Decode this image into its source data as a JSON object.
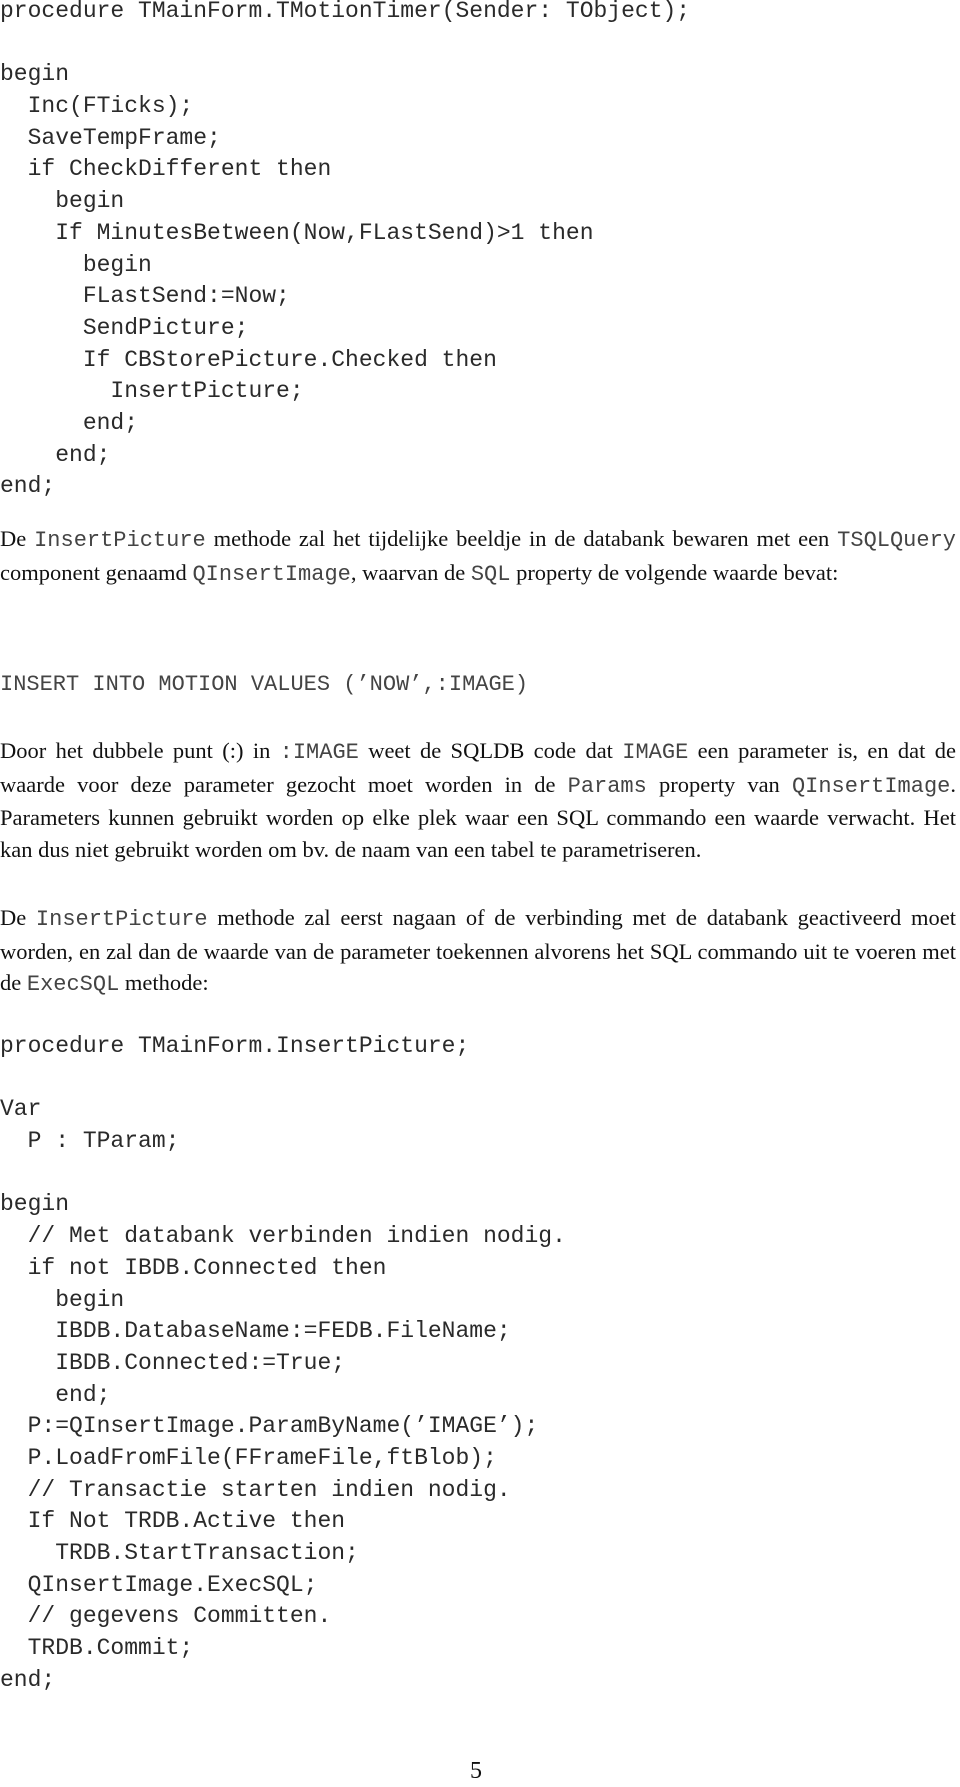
{
  "code_block_1": [
    "procedure TMainForm.TMotionTimer(Sender: TObject);",
    "",
    "begin",
    "  Inc(FTicks);",
    "  SaveTempFrame;",
    "  if CheckDifferent then",
    "    begin",
    "    If MinutesBetween(Now,FLastSend)>1 then",
    "      begin",
    "      FLastSend:=Now;",
    "      SendPicture;",
    "      If CBStorePicture.Checked then",
    "        InsertPicture;",
    "      end;",
    "    end;",
    "end;"
  ],
  "para1": {
    "t1": "De ",
    "c1": "InsertPicture",
    "t2": " methode zal het tijdelijke beeldje in de databank bewaren met een ",
    "c2": "TSQLQuery",
    "t3": " component genaamd ",
    "c3": "QInsertImage",
    "t4": ", waarvan de ",
    "c4": "SQL",
    "t5": " property de volgende waarde bevat:"
  },
  "sql_statement": "INSERT INTO MOTION VALUES (’NOW’,:IMAGE)",
  "para2": {
    "t1": "Door het dubbele punt (:) in ",
    "c1": ":IMAGE",
    "t2": " weet de SQLDB code dat ",
    "c2": "IMAGE",
    "t3": " een parameter is, en dat de waarde voor deze parameter gezocht moet worden in de ",
    "c3": "Params",
    "t4": " property van ",
    "c4": "QInsertImage",
    "t5": ". Parameters kunnen gebruikt worden op elke plek waar een SQL commando een waarde verwacht. Het kan dus niet gebruikt worden om bv. de naam van een tabel te parametriseren."
  },
  "para3": {
    "t1": "De ",
    "c1": "InsertPicture",
    "t2": " methode zal eerst nagaan of de verbinding met de databank geactiveerd moet worden, en zal dan de waarde van de parameter toekennen alvorens het SQL commando uit te voeren met de ",
    "c2": "ExecSQL",
    "t3": " methode:"
  },
  "code_block_2": [
    "procedure TMainForm.InsertPicture;",
    "",
    "Var",
    "  P : TParam;",
    "",
    "begin",
    "  // Met databank verbinden indien nodig.",
    "  if not IBDB.Connected then",
    "    begin",
    "    IBDB.DatabaseName:=FEDB.FileName;",
    "    IBDB.Connected:=True;",
    "    end;",
    "  P:=QInsertImage.ParamByName(’IMAGE’);",
    "  P.LoadFromFile(FFrameFile,ftBlob);",
    "  // Transactie starten indien nodig.",
    "  If Not TRDB.Active then",
    "    TRDB.StartTransaction;",
    "  QInsertImage.ExecSQL;",
    "  // gegevens Committen.",
    "  TRDB.Commit;",
    "end;"
  ],
  "page_number": "5"
}
